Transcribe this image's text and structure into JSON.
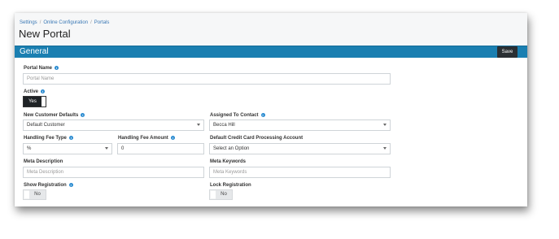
{
  "breadcrumb": [
    "Settings",
    "Online Configuration",
    "Portals"
  ],
  "page_title": "New Portal",
  "section_title": "General",
  "save_label": "Save",
  "fields": {
    "portal_name": {
      "label": "Portal Name",
      "placeholder": "Portal Name",
      "value": ""
    },
    "active": {
      "label": "Active",
      "value": "Yes"
    },
    "new_customer_defaults": {
      "label": "New Customer Defaults",
      "value": "Default Customer"
    },
    "assigned_to_contact": {
      "label": "Assigned To Contact",
      "value": "Becca Hill"
    },
    "handling_fee_type": {
      "label": "Handling Fee Type",
      "value": "%"
    },
    "handling_fee_amount": {
      "label": "Handling Fee Amount",
      "value": "0"
    },
    "default_cc_account": {
      "label": "Default Credit Card Processing Account",
      "value": "Select an Option"
    },
    "meta_description": {
      "label": "Meta Description",
      "placeholder": "Meta Description",
      "value": ""
    },
    "meta_keywords": {
      "label": "Meta Keywords",
      "placeholder": "Meta Keywords",
      "value": ""
    },
    "show_registration": {
      "label": "Show Registration",
      "value": "No"
    },
    "lock_registration": {
      "label": "Lock Registration",
      "value": "No"
    }
  },
  "colors": {
    "section_bar": "#1a7fb1",
    "save_button": "#2a2f33",
    "link": "#3a78b5",
    "info_icon": "#2a8bd0"
  },
  "icons": {
    "info": "info-icon",
    "dropdown": "chevron-down-icon"
  }
}
